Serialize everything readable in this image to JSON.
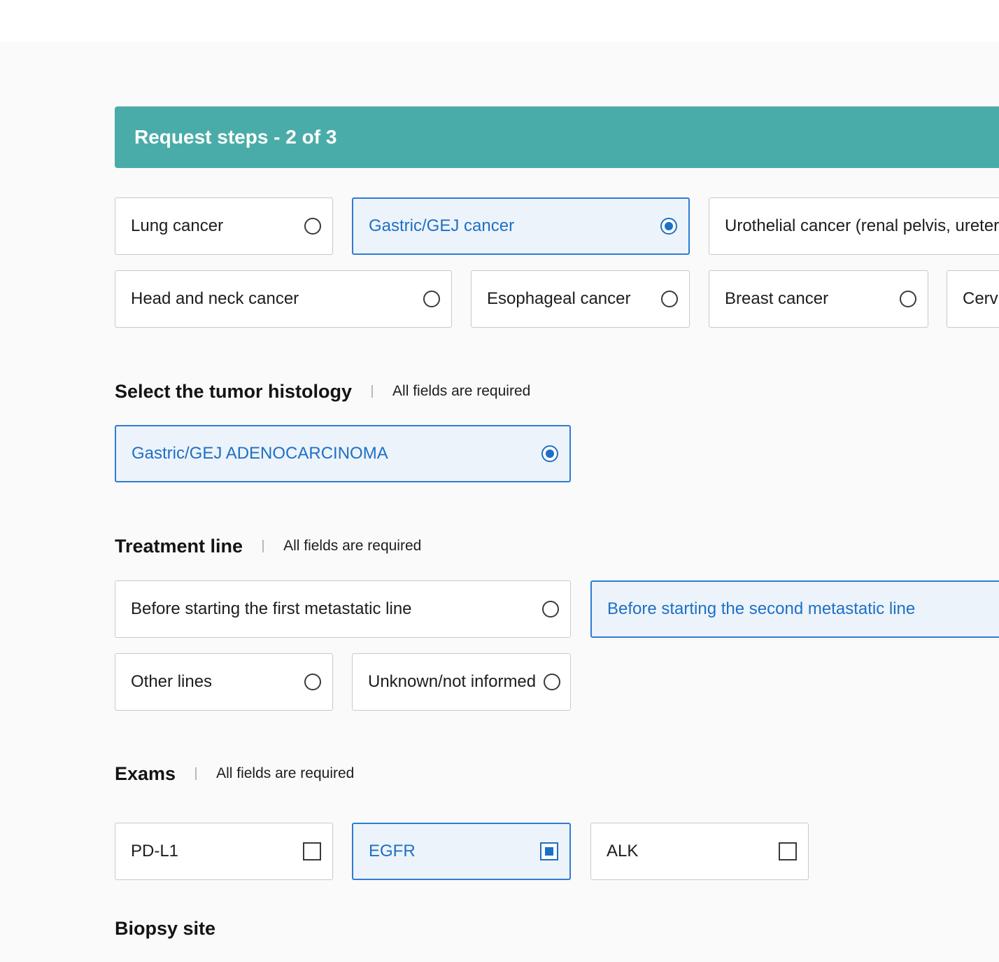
{
  "header": {
    "steps_title": "Request steps - 2 of 3"
  },
  "cancer_types": [
    {
      "label": "Lung cancer",
      "selected": false
    },
    {
      "label": "Gastric/GEJ cancer",
      "selected": true
    },
    {
      "label": "Urothelial cancer (renal pelvis, ureter",
      "selected": false
    },
    {
      "label": "Head and neck cancer",
      "selected": false
    },
    {
      "label": "Esophageal cancer",
      "selected": false
    },
    {
      "label": "Breast cancer",
      "selected": false
    },
    {
      "label": "Cervi",
      "selected": false
    }
  ],
  "histology": {
    "title": "Select the tumor histology",
    "note": "All fields are required",
    "options": [
      {
        "label": "Gastric/GEJ ADENOCARCINOMA",
        "selected": true
      }
    ]
  },
  "treatment_line": {
    "title": "Treatment line",
    "note": "All fields are required",
    "options": [
      {
        "label": "Before starting the first metastatic line",
        "selected": false
      },
      {
        "label": "Before starting the second metastatic line",
        "selected": true
      },
      {
        "label": "Other lines",
        "selected": false
      },
      {
        "label": "Unknown/not informed",
        "selected": false
      }
    ]
  },
  "exams": {
    "title": "Exams",
    "note": "All fields are required",
    "options": [
      {
        "label": "PD-L1",
        "checked": false
      },
      {
        "label": "EGFR",
        "checked": true
      },
      {
        "label": "ALK",
        "checked": false
      }
    ]
  },
  "biopsy_site": {
    "title": "Biopsy site"
  },
  "colors": {
    "banner": "#4aaca8",
    "accent": "#1e70c4",
    "selected_bg": "#edf3fb"
  }
}
